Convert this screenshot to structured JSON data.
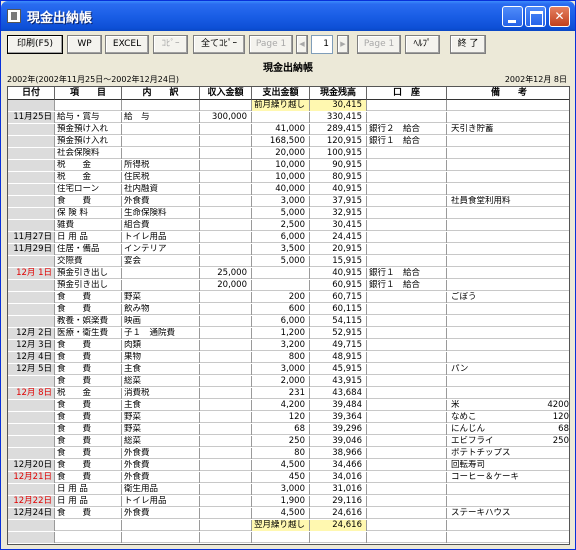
{
  "window": {
    "title": "現金出納帳"
  },
  "toolbar": {
    "print": "印刷(F5)",
    "wp": "WP",
    "excel": "EXCEL",
    "copy": "ｺﾋﾟｰ",
    "all_copy": "全てｺﾋﾟｰ",
    "page1": "Page 1",
    "page_value": "1",
    "page1b": "Page 1",
    "help": "ﾍﾙﾌﾟ",
    "exit": "終 了",
    "prev_arrow": "◀",
    "next_arrow": "▶"
  },
  "report": {
    "title": "現金出納帳",
    "period": "2002年(2002年11月25日～2002年12月24日)",
    "print_date": "2002年12月 8日"
  },
  "columns": [
    "日付",
    "項　　目",
    "内　　訳",
    "収入金額",
    "支出金額",
    "現金残高",
    "口　座",
    "備　　考"
  ],
  "rows": [
    {
      "date": "",
      "item": "",
      "desc": "",
      "income": "",
      "expense": "前月繰り越し",
      "balance": "30,415",
      "account": "",
      "note": "",
      "note_amt": "",
      "red": false,
      "hl": true
    },
    {
      "date": "11月25日",
      "item": "給与・賞与",
      "desc": "給　与",
      "income": "300,000",
      "expense": "",
      "balance": "330,415",
      "account": "",
      "note": "",
      "note_amt": "",
      "red": false,
      "hl": false
    },
    {
      "date": "",
      "item": "預金預け入れ",
      "desc": "",
      "income": "",
      "expense": "41,000",
      "balance": "289,415",
      "account": "銀行２　給合",
      "note": "天引き貯蓄",
      "note_amt": "",
      "red": false,
      "hl": false
    },
    {
      "date": "",
      "item": "預金預け入れ",
      "desc": "",
      "income": "",
      "expense": "168,500",
      "balance": "120,915",
      "account": "銀行１　給合",
      "note": "",
      "note_amt": "",
      "red": false,
      "hl": false
    },
    {
      "date": "",
      "item": "社会保険料",
      "desc": "",
      "income": "",
      "expense": "20,000",
      "balance": "100,915",
      "account": "",
      "note": "",
      "note_amt": "",
      "red": false,
      "hl": false
    },
    {
      "date": "",
      "item": "税　　金",
      "desc": "所得税",
      "income": "",
      "expense": "10,000",
      "balance": "90,915",
      "account": "",
      "note": "",
      "note_amt": "",
      "red": false,
      "hl": false
    },
    {
      "date": "",
      "item": "税　　金",
      "desc": "住民税",
      "income": "",
      "expense": "10,000",
      "balance": "80,915",
      "account": "",
      "note": "",
      "note_amt": "",
      "red": false,
      "hl": false
    },
    {
      "date": "",
      "item": "住宅ローン",
      "desc": "社内融資",
      "income": "",
      "expense": "40,000",
      "balance": "40,915",
      "account": "",
      "note": "",
      "note_amt": "",
      "red": false,
      "hl": false
    },
    {
      "date": "",
      "item": "食　　費",
      "desc": "外食費",
      "income": "",
      "expense": "3,000",
      "balance": "37,915",
      "account": "",
      "note": "社員食堂利用料",
      "note_amt": "",
      "red": false,
      "hl": false
    },
    {
      "date": "",
      "item": "保 険 料",
      "desc": "生命保険料",
      "income": "",
      "expense": "5,000",
      "balance": "32,915",
      "account": "",
      "note": "",
      "note_amt": "",
      "red": false,
      "hl": false
    },
    {
      "date": "",
      "item": "雑費",
      "desc": "組合費",
      "income": "",
      "expense": "2,500",
      "balance": "30,415",
      "account": "",
      "note": "",
      "note_amt": "",
      "red": false,
      "hl": false
    },
    {
      "date": "11月27日",
      "item": "日 用 品",
      "desc": "トイレ用品",
      "income": "",
      "expense": "6,000",
      "balance": "24,415",
      "account": "",
      "note": "",
      "note_amt": "",
      "red": false,
      "hl": false
    },
    {
      "date": "11月29日",
      "item": "住居・備品",
      "desc": "インテリア",
      "income": "",
      "expense": "3,500",
      "balance": "20,915",
      "account": "",
      "note": "",
      "note_amt": "",
      "red": false,
      "hl": false
    },
    {
      "date": "",
      "item": "交際費",
      "desc": "宴会",
      "income": "",
      "expense": "5,000",
      "balance": "15,915",
      "account": "",
      "note": "",
      "note_amt": "",
      "red": false,
      "hl": false
    },
    {
      "date": "12月 1日",
      "item": "預金引き出し",
      "desc": "",
      "income": "25,000",
      "expense": "",
      "balance": "40,915",
      "account": "銀行１　給合",
      "note": "",
      "note_amt": "",
      "red": true,
      "hl": false
    },
    {
      "date": "",
      "item": "預金引き出し",
      "desc": "",
      "income": "20,000",
      "expense": "",
      "balance": "60,915",
      "account": "銀行１　給合",
      "note": "",
      "note_amt": "",
      "red": false,
      "hl": false
    },
    {
      "date": "",
      "item": "食　　費",
      "desc": "野菜",
      "income": "",
      "expense": "200",
      "balance": "60,715",
      "account": "",
      "note": "ごぼう",
      "note_amt": "",
      "red": false,
      "hl": false
    },
    {
      "date": "",
      "item": "食　　費",
      "desc": "飲み物",
      "income": "",
      "expense": "600",
      "balance": "60,115",
      "account": "",
      "note": "",
      "note_amt": "",
      "red": false,
      "hl": false
    },
    {
      "date": "",
      "item": "教養・娯楽費",
      "desc": "映画",
      "income": "",
      "expense": "6,000",
      "balance": "54,115",
      "account": "",
      "note": "",
      "note_amt": "",
      "red": false,
      "hl": false
    },
    {
      "date": "12月 2日",
      "item": "医療・衛生費",
      "desc": "子１　通院費",
      "income": "",
      "expense": "1,200",
      "balance": "52,915",
      "account": "",
      "note": "",
      "note_amt": "",
      "red": false,
      "hl": false
    },
    {
      "date": "12月 3日",
      "item": "食　　費",
      "desc": "肉類",
      "income": "",
      "expense": "3,200",
      "balance": "49,715",
      "account": "",
      "note": "",
      "note_amt": "",
      "red": false,
      "hl": false
    },
    {
      "date": "12月 4日",
      "item": "食　　費",
      "desc": "果物",
      "income": "",
      "expense": "800",
      "balance": "48,915",
      "account": "",
      "note": "",
      "note_amt": "",
      "red": false,
      "hl": false
    },
    {
      "date": "12月 5日",
      "item": "食　　費",
      "desc": "主食",
      "income": "",
      "expense": "3,000",
      "balance": "45,915",
      "account": "",
      "note": "パン",
      "note_amt": "",
      "red": false,
      "hl": false
    },
    {
      "date": "",
      "item": "食　　費",
      "desc": "総菜",
      "income": "",
      "expense": "2,000",
      "balance": "43,915",
      "account": "",
      "note": "",
      "note_amt": "",
      "red": false,
      "hl": false
    },
    {
      "date": "12月 8日",
      "item": "税　　金",
      "desc": "消費税",
      "income": "",
      "expense": "231",
      "balance": "43,684",
      "account": "",
      "note": "",
      "note_amt": "",
      "red": true,
      "hl": false
    },
    {
      "date": "",
      "item": "食　　費",
      "desc": "主食",
      "income": "",
      "expense": "4,200",
      "balance": "39,484",
      "account": "",
      "note": "米",
      "note_amt": "4200",
      "red": false,
      "hl": false
    },
    {
      "date": "",
      "item": "食　　費",
      "desc": "野菜",
      "income": "",
      "expense": "120",
      "balance": "39,364",
      "account": "",
      "note": "なめこ",
      "note_amt": "120",
      "red": false,
      "hl": false
    },
    {
      "date": "",
      "item": "食　　費",
      "desc": "野菜",
      "income": "",
      "expense": "68",
      "balance": "39,296",
      "account": "",
      "note": "にんじん",
      "note_amt": "68",
      "red": false,
      "hl": false
    },
    {
      "date": "",
      "item": "食　　費",
      "desc": "総菜",
      "income": "",
      "expense": "250",
      "balance": "39,046",
      "account": "",
      "note": "エビフライ",
      "note_amt": "250",
      "red": false,
      "hl": false
    },
    {
      "date": "",
      "item": "食　　費",
      "desc": "外食費",
      "income": "",
      "expense": "80",
      "balance": "38,966",
      "account": "",
      "note": "ポテトチップス",
      "note_amt": "",
      "red": false,
      "hl": false
    },
    {
      "date": "12月20日",
      "item": "食　　費",
      "desc": "外食費",
      "income": "",
      "expense": "4,500",
      "balance": "34,466",
      "account": "",
      "note": "回転寿司",
      "note_amt": "",
      "red": false,
      "hl": false
    },
    {
      "date": "12月21日",
      "item": "食　　費",
      "desc": "外食費",
      "income": "",
      "expense": "450",
      "balance": "34,016",
      "account": "",
      "note": "コーヒー＆ケーキ",
      "note_amt": "",
      "red": true,
      "hl": false
    },
    {
      "date": "",
      "item": "日 用 品",
      "desc": "衛生用品",
      "income": "",
      "expense": "3,000",
      "balance": "31,016",
      "account": "",
      "note": "",
      "note_amt": "",
      "red": false,
      "hl": false
    },
    {
      "date": "12月22日",
      "item": "日 用 品",
      "desc": "トイレ用品",
      "income": "",
      "expense": "1,900",
      "balance": "29,116",
      "account": "",
      "note": "",
      "note_amt": "",
      "red": true,
      "hl": false
    },
    {
      "date": "12月24日",
      "item": "食　　費",
      "desc": "外食費",
      "income": "",
      "expense": "4,500",
      "balance": "24,616",
      "account": "",
      "note": "ステーキハウス",
      "note_amt": "",
      "red": false,
      "hl": false
    },
    {
      "date": "",
      "item": "",
      "desc": "",
      "income": "",
      "expense": "翌月繰り越し",
      "balance": "24,616",
      "account": "",
      "note": "",
      "note_amt": "",
      "red": false,
      "hl": true
    },
    {
      "date": "",
      "item": "",
      "desc": "",
      "income": "",
      "expense": "",
      "balance": "",
      "account": "",
      "note": "",
      "note_amt": "",
      "red": false,
      "hl": false
    },
    {
      "date": "",
      "item": "",
      "desc": "",
      "income": "",
      "expense": "",
      "balance": "",
      "account": "",
      "note": "",
      "note_amt": "",
      "red": false,
      "hl": false
    }
  ]
}
